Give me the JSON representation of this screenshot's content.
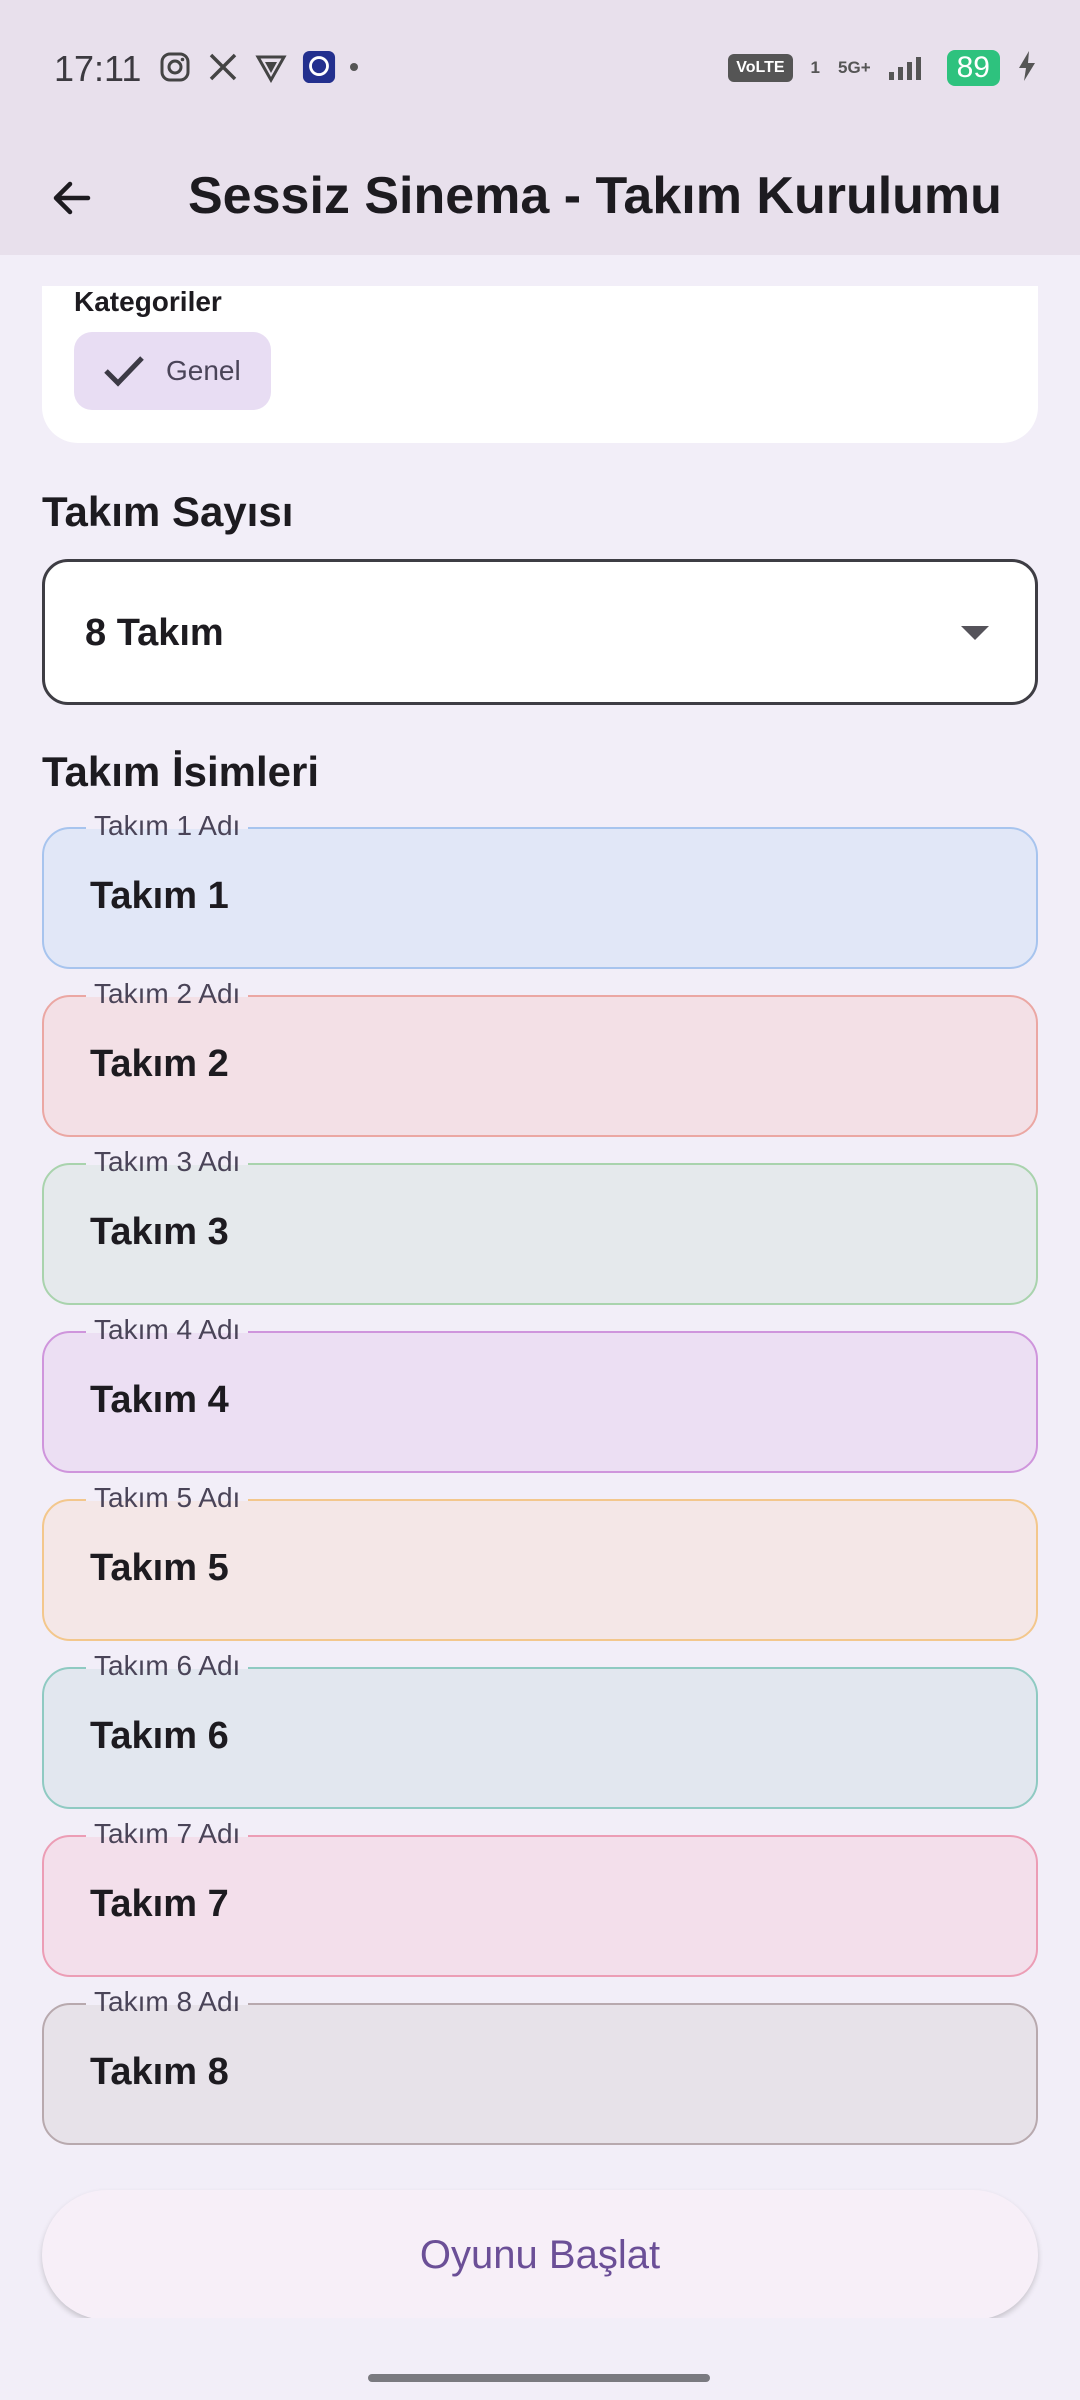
{
  "status_bar": {
    "time": "17:11",
    "icons_left": [
      "instagram-icon",
      "x-icon",
      "vpn-icon",
      "app-notification-icon"
    ],
    "volte": "VoLTE",
    "sim": "1",
    "network": "5G+",
    "battery": "89"
  },
  "app_bar": {
    "title": "Sessiz Sinema - Takım Kurulumu",
    "back_icon": "arrow-left-icon"
  },
  "categories": {
    "label": "Kategoriler",
    "chips": [
      {
        "label": "Genel",
        "selected": true
      }
    ]
  },
  "team_count": {
    "heading": "Takım Sayısı",
    "selected": "8 Takım"
  },
  "team_names": {
    "heading": "Takım İsimleri",
    "teams": [
      {
        "label": "Takım 1 Adı",
        "value": "Takım 1",
        "border": "#a7c4ee",
        "fill": "#e1e7f7"
      },
      {
        "label": "Takım 2 Adı",
        "value": "Takım 2",
        "border": "#eba7a3",
        "fill": "#f3e0e6"
      },
      {
        "label": "Takım 3 Adı",
        "value": "Takım 3",
        "border": "#a9d3ad",
        "fill": "#e5e9ec"
      },
      {
        "label": "Takım 4 Adı",
        "value": "Takım 4",
        "border": "#cf95dc",
        "fill": "#ecdff3"
      },
      {
        "label": "Takım 5 Adı",
        "value": "Takım 5",
        "border": "#f3c78c",
        "fill": "#f4e7e7"
      },
      {
        "label": "Takım 6 Adı",
        "value": "Takım 6",
        "border": "#8fcac2",
        "fill": "#e2e7ef"
      },
      {
        "label": "Takım 7 Adı",
        "value": "Takım 7",
        "border": "#ec9db5",
        "fill": "#f3dfeb"
      },
      {
        "label": "Takım 8 Adı",
        "value": "Takım 8",
        "border": "#b8a9ae",
        "fill": "#e7e2e9"
      }
    ]
  },
  "start_button": {
    "label": "Oyunu Başlat"
  }
}
